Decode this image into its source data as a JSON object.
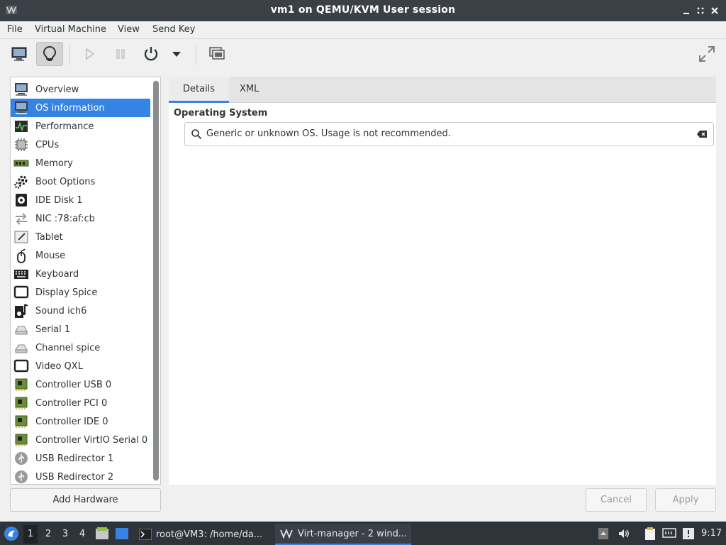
{
  "window": {
    "title": "vm1 on QEMU/KVM User session",
    "controls": [
      "minimize",
      "maximize",
      "close"
    ]
  },
  "menu": {
    "items": [
      "File",
      "Virtual Machine",
      "View",
      "Send Key"
    ]
  },
  "toolbar": {
    "buttons": [
      {
        "name": "console",
        "icon": "monitor-icon",
        "active": false
      },
      {
        "name": "details",
        "icon": "lightbulb-icon",
        "active": true
      },
      {
        "name": "run",
        "icon": "play-icon",
        "enabled": false
      },
      {
        "name": "pause",
        "icon": "pause-icon",
        "enabled": false
      },
      {
        "name": "shutdown",
        "icon": "power-icon",
        "enabled": true
      },
      {
        "name": "shutdown-menu",
        "icon": "chevron-down-icon",
        "enabled": true
      },
      {
        "name": "snapshots",
        "icon": "snapshot-icon",
        "enabled": true
      },
      {
        "name": "fullscreen",
        "icon": "fullscreen-icon",
        "enabled": true
      }
    ]
  },
  "sidebar": {
    "items": [
      {
        "label": "Overview",
        "icon": "monitor-icon"
      },
      {
        "label": "OS information",
        "icon": "monitor-icon",
        "selected": true
      },
      {
        "label": "Performance",
        "icon": "performance-icon"
      },
      {
        "label": "CPUs",
        "icon": "cpu-icon"
      },
      {
        "label": "Memory",
        "icon": "memory-icon"
      },
      {
        "label": "Boot Options",
        "icon": "gear-icon"
      },
      {
        "label": "IDE Disk 1",
        "icon": "disk-icon"
      },
      {
        "label": "NIC :78:af:cb",
        "icon": "network-icon"
      },
      {
        "label": "Tablet",
        "icon": "tablet-icon"
      },
      {
        "label": "Mouse",
        "icon": "mouse-icon"
      },
      {
        "label": "Keyboard",
        "icon": "keyboard-icon"
      },
      {
        "label": "Display Spice",
        "icon": "display-icon"
      },
      {
        "label": "Sound ich6",
        "icon": "sound-icon"
      },
      {
        "label": "Serial 1",
        "icon": "serial-icon"
      },
      {
        "label": "Channel spice",
        "icon": "serial-icon"
      },
      {
        "label": "Video QXL",
        "icon": "display-icon"
      },
      {
        "label": "Controller USB 0",
        "icon": "controller-icon"
      },
      {
        "label": "Controller PCI 0",
        "icon": "controller-icon"
      },
      {
        "label": "Controller IDE 0",
        "icon": "controller-icon"
      },
      {
        "label": "Controller VirtIO Serial 0",
        "icon": "controller-icon"
      },
      {
        "label": "USB Redirector 1",
        "icon": "usb-icon"
      },
      {
        "label": "USB Redirector 2",
        "icon": "usb-icon"
      }
    ],
    "add_hardware_label": "Add Hardware"
  },
  "content": {
    "tabs": [
      {
        "label": "Details",
        "active": true
      },
      {
        "label": "XML",
        "active": false
      }
    ],
    "section_title": "Operating System",
    "os_value": "Generic or unknown OS. Usage is not recommended."
  },
  "actions": {
    "cancel_label": "Cancel",
    "apply_label": "Apply"
  },
  "taskbar": {
    "workspaces": [
      "1",
      "2",
      "3",
      "4"
    ],
    "active_workspace": "1",
    "tasks": [
      {
        "label": "root@VM3: /home/da...",
        "icon": "terminal-icon",
        "active": false
      },
      {
        "label": "Virt-manager - 2 wind...",
        "icon": "virt-manager-icon",
        "active": true
      }
    ],
    "clock": "9:17"
  },
  "colors": {
    "accent": "#3584e4",
    "titlebar": "#3b4047",
    "taskbar": "#2f343a"
  }
}
